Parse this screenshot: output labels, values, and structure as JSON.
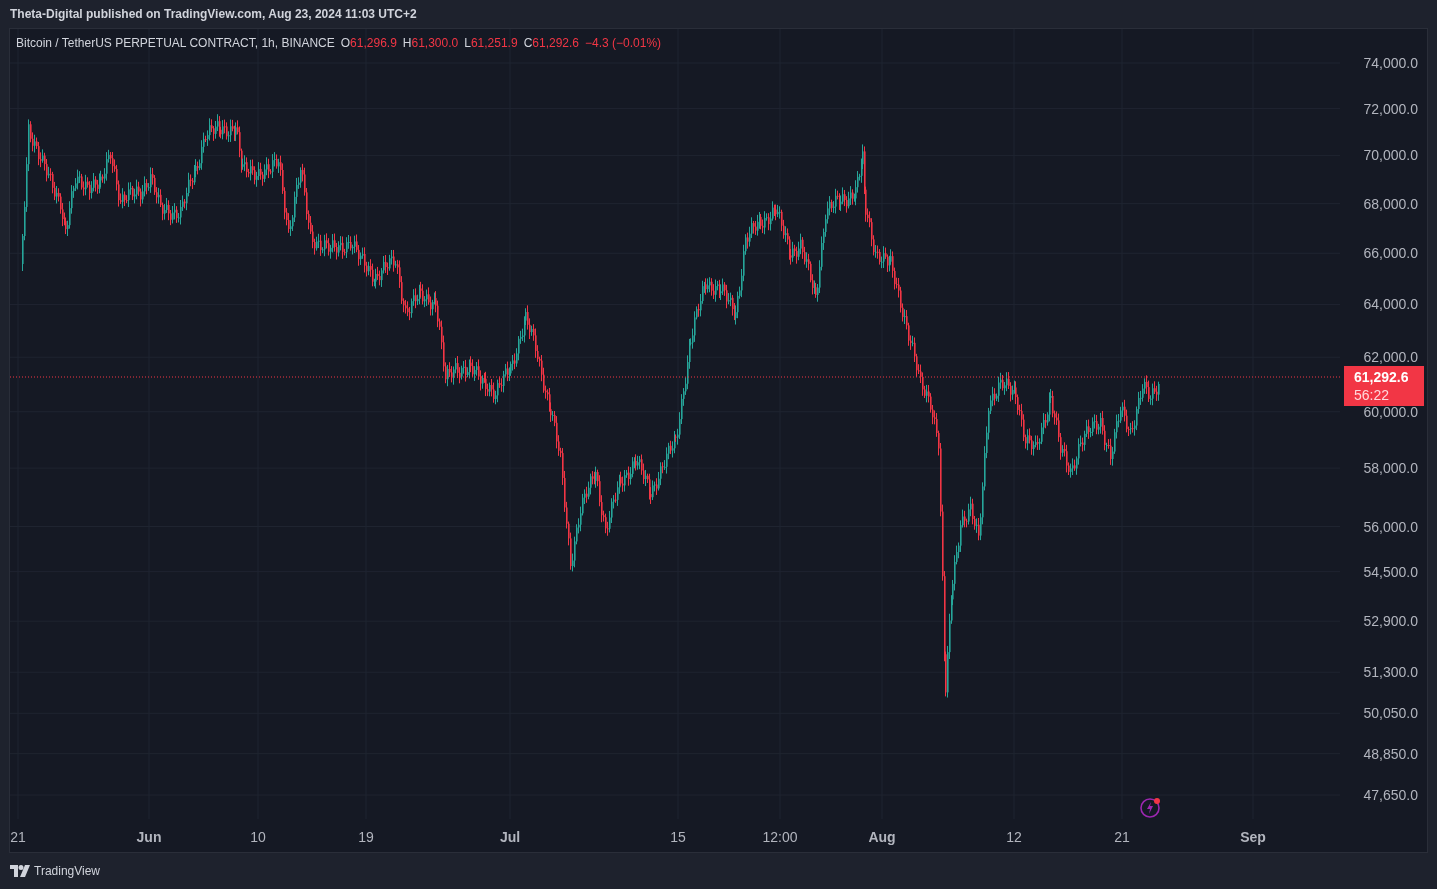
{
  "header": {
    "text": "Theta-Digital published on TradingView.com, Aug 23, 2024 11:03 UTC+2"
  },
  "chart": {
    "symbol": "Bitcoin / TetherUS PERPETUAL CONTRACT, 1h, BINANCE",
    "ohlc": [
      {
        "label": "O",
        "value": "61,296.9"
      },
      {
        "label": "H",
        "value": "61,300.0"
      },
      {
        "label": "L",
        "value": "61,251.9"
      },
      {
        "label": "C",
        "value": "61,292.6"
      }
    ],
    "change": "−4.3 (−0.01%)",
    "price_axis": [
      "74,000.0",
      "72,000.0",
      "70,000.0",
      "68,000.0",
      "66,000.0",
      "64,000.0",
      "62,000.0",
      "60,000.0",
      "58,000.0",
      "56,000.0",
      "54,500.0",
      "52,900.0",
      "51,300.0",
      "50,050.0",
      "48,850.0",
      "47,650.0"
    ],
    "time_axis": [
      {
        "label": "21",
        "kind": "day"
      },
      {
        "label": "Jun",
        "kind": "month"
      },
      {
        "label": "10",
        "kind": "day"
      },
      {
        "label": "19",
        "kind": "day"
      },
      {
        "label": "Jul",
        "kind": "month"
      },
      {
        "label": "15",
        "kind": "day"
      },
      {
        "label": "12:00",
        "kind": "day"
      },
      {
        "label": "Aug",
        "kind": "month"
      },
      {
        "label": "12",
        "kind": "day"
      },
      {
        "label": "21",
        "kind": "day"
      },
      {
        "label": "Sep",
        "kind": "month"
      }
    ],
    "last_price": {
      "price": "61,292.6",
      "countdown": "56:22"
    }
  },
  "footer": {
    "brand": "TradingView"
  }
}
